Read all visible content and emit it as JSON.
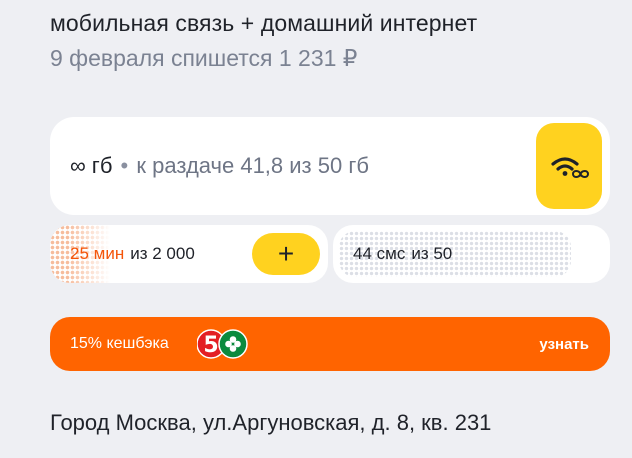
{
  "plan": {
    "title": "мобильная связь + домашний интернет",
    "billing": "9 февраля спишется 1 231 ₽"
  },
  "internet": {
    "amount": "∞ гб",
    "separator": "•",
    "share": "к раздаче 41,8 из 50 гб",
    "icon": "wifi-infinity-icon"
  },
  "minutes": {
    "used": "25 мин",
    "of": "из 2 000",
    "add_label": "+"
  },
  "sms": {
    "used": "44 смс",
    "of": "из 50"
  },
  "cashback": {
    "label": "15% кешбэка",
    "partner_logo": "pyaterochka-logo",
    "logo_text": "5",
    "action": "узнать"
  },
  "address": "Город Москва, ул.Аргуновская, д. 8, кв. 231",
  "colors": {
    "background": "#eeeff3",
    "accent_yellow": "#ffd21f",
    "accent_orange": "#ff6400",
    "minutes_highlight": "#f4550a"
  }
}
